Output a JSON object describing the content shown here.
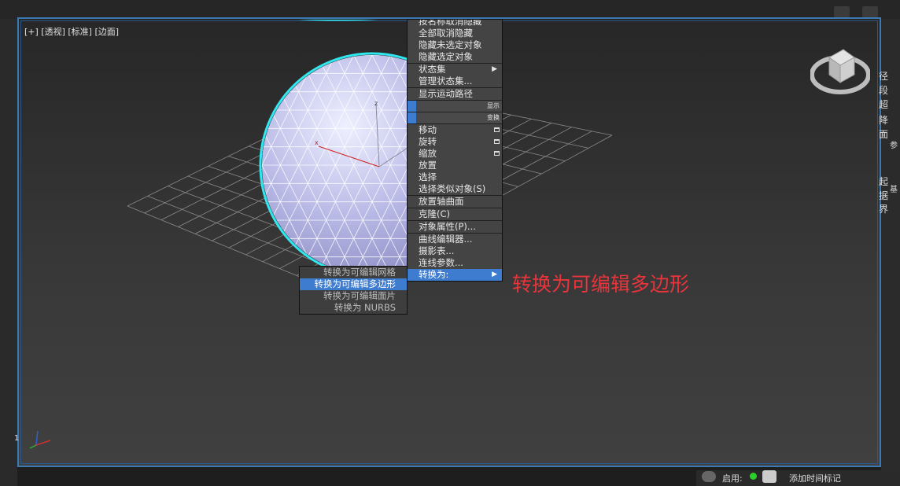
{
  "viewport": {
    "label": "[+] [透视] [标准] [边面]",
    "side_number": "1"
  },
  "quad_menu": {
    "items": [
      {
        "label": "按名称取消隐藏",
        "id": "unhide-by-name"
      },
      {
        "label": "全部取消隐藏",
        "id": "unhide-all"
      },
      {
        "label": "隐藏未选定对象",
        "id": "hide-unselected"
      },
      {
        "label": "隐藏选定对象",
        "id": "hide-selected"
      },
      {
        "label": "状态集",
        "id": "state-sets"
      },
      {
        "label": "管理状态集...",
        "id": "manage-state-sets"
      },
      {
        "label": "显示运动路径",
        "id": "show-motion-path"
      },
      {
        "label": "移动",
        "id": "move"
      },
      {
        "label": "旋转",
        "id": "rotate"
      },
      {
        "label": "缩放",
        "id": "scale"
      },
      {
        "label": "放置",
        "id": "place"
      },
      {
        "label": "选择",
        "id": "select"
      },
      {
        "label": "选择类似对象(S)",
        "id": "select-similar"
      },
      {
        "label": "放置轴曲面",
        "id": "place-pivot-surface"
      },
      {
        "label": "克隆(C)",
        "id": "clone"
      },
      {
        "label": "对象属性(P)...",
        "id": "object-properties"
      },
      {
        "label": "曲线编辑器...",
        "id": "curve-editor"
      },
      {
        "label": "摄影表...",
        "id": "dope-sheet"
      },
      {
        "label": "连线参数...",
        "id": "wire-parameters"
      },
      {
        "label": "转换为:",
        "id": "convert-to"
      }
    ],
    "quad_display": "显示",
    "quad_transform": "变换"
  },
  "submenu": {
    "items": [
      {
        "label": "转换为可编辑网格",
        "id": "to-editable-mesh"
      },
      {
        "label": "转换为可编辑多边形",
        "id": "to-editable-poly"
      },
      {
        "label": "转换为可编辑面片",
        "id": "to-editable-patch"
      },
      {
        "label": "转换为 NURBS",
        "id": "to-nurbs"
      }
    ]
  },
  "annotation": "转换为可编辑多边形",
  "right_panel": {
    "chars": [
      "径",
      "段",
      "超",
      "降",
      "面",
      "参",
      "起",
      "据",
      "界",
      "基"
    ]
  },
  "statusbar": {
    "auto_label": "启用:",
    "key_label": "添加时间标记"
  },
  "colors": {
    "viewport_border": "#3c78b4",
    "menu_active": "#3d7ccf",
    "annotation": "#e8343a",
    "sphere_fill": "#b4b4e2",
    "sphere_outline": "#2fe8f0"
  }
}
